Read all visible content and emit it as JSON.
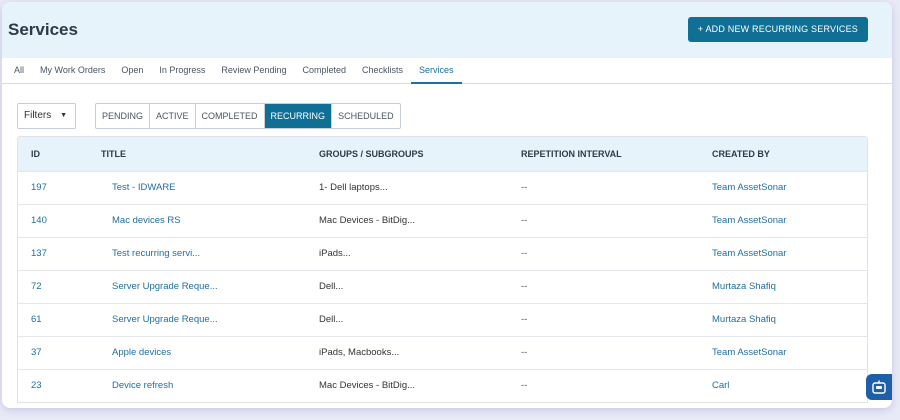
{
  "header": {
    "title": "Services",
    "add_button": "+ ADD NEW RECURRING SERVICES"
  },
  "tabs": [
    {
      "label": "All"
    },
    {
      "label": "My Work Orders"
    },
    {
      "label": "Open"
    },
    {
      "label": "In Progress"
    },
    {
      "label": "Review Pending"
    },
    {
      "label": "Completed"
    },
    {
      "label": "Checklists"
    },
    {
      "label": "Services",
      "active": true
    }
  ],
  "filters": {
    "label": "Filters"
  },
  "segments": [
    {
      "label": "PENDING"
    },
    {
      "label": "ACTIVE"
    },
    {
      "label": "COMPLETED"
    },
    {
      "label": "RECURRING",
      "active": true
    },
    {
      "label": "SCHEDULED"
    }
  ],
  "table": {
    "columns": [
      "ID",
      "TITLE",
      "GROUPS / SUBGROUPS",
      "REPETITION INTERVAL",
      "CREATED BY"
    ],
    "rows": [
      {
        "id": "197",
        "title": "Test - IDWARE",
        "group": "1- Dell laptops...",
        "rep": "--",
        "by": "Team AssetSonar"
      },
      {
        "id": "140",
        "title": "Mac devices RS",
        "group": "Mac Devices - BitDig...",
        "rep": "--",
        "by": "Team AssetSonar"
      },
      {
        "id": "137",
        "title": "Test recurring servi...",
        "group": "iPads...",
        "rep": "--",
        "by": "Team AssetSonar"
      },
      {
        "id": "72",
        "title": "Server Upgrade Reque...",
        "group": "Dell...",
        "rep": "--",
        "by": "Murtaza Shafiq"
      },
      {
        "id": "61",
        "title": "Server Upgrade Reque...",
        "group": "Dell...",
        "rep": "--",
        "by": "Murtaza Shafiq"
      },
      {
        "id": "37",
        "title": "Apple devices",
        "group": "iPads, Macbooks...",
        "rep": "--",
        "by": "Team AssetSonar"
      },
      {
        "id": "23",
        "title": "Device refresh",
        "group": "Mac Devices - BitDig...",
        "rep": "--",
        "by": "Carl"
      }
    ]
  },
  "colors": {
    "accent": "#0f6f94",
    "link": "#1d6fa0",
    "header_bg": "#e6f3fb"
  },
  "icons": {
    "fab": "chat-bot-icon",
    "dropdown": "caret-down-icon"
  }
}
